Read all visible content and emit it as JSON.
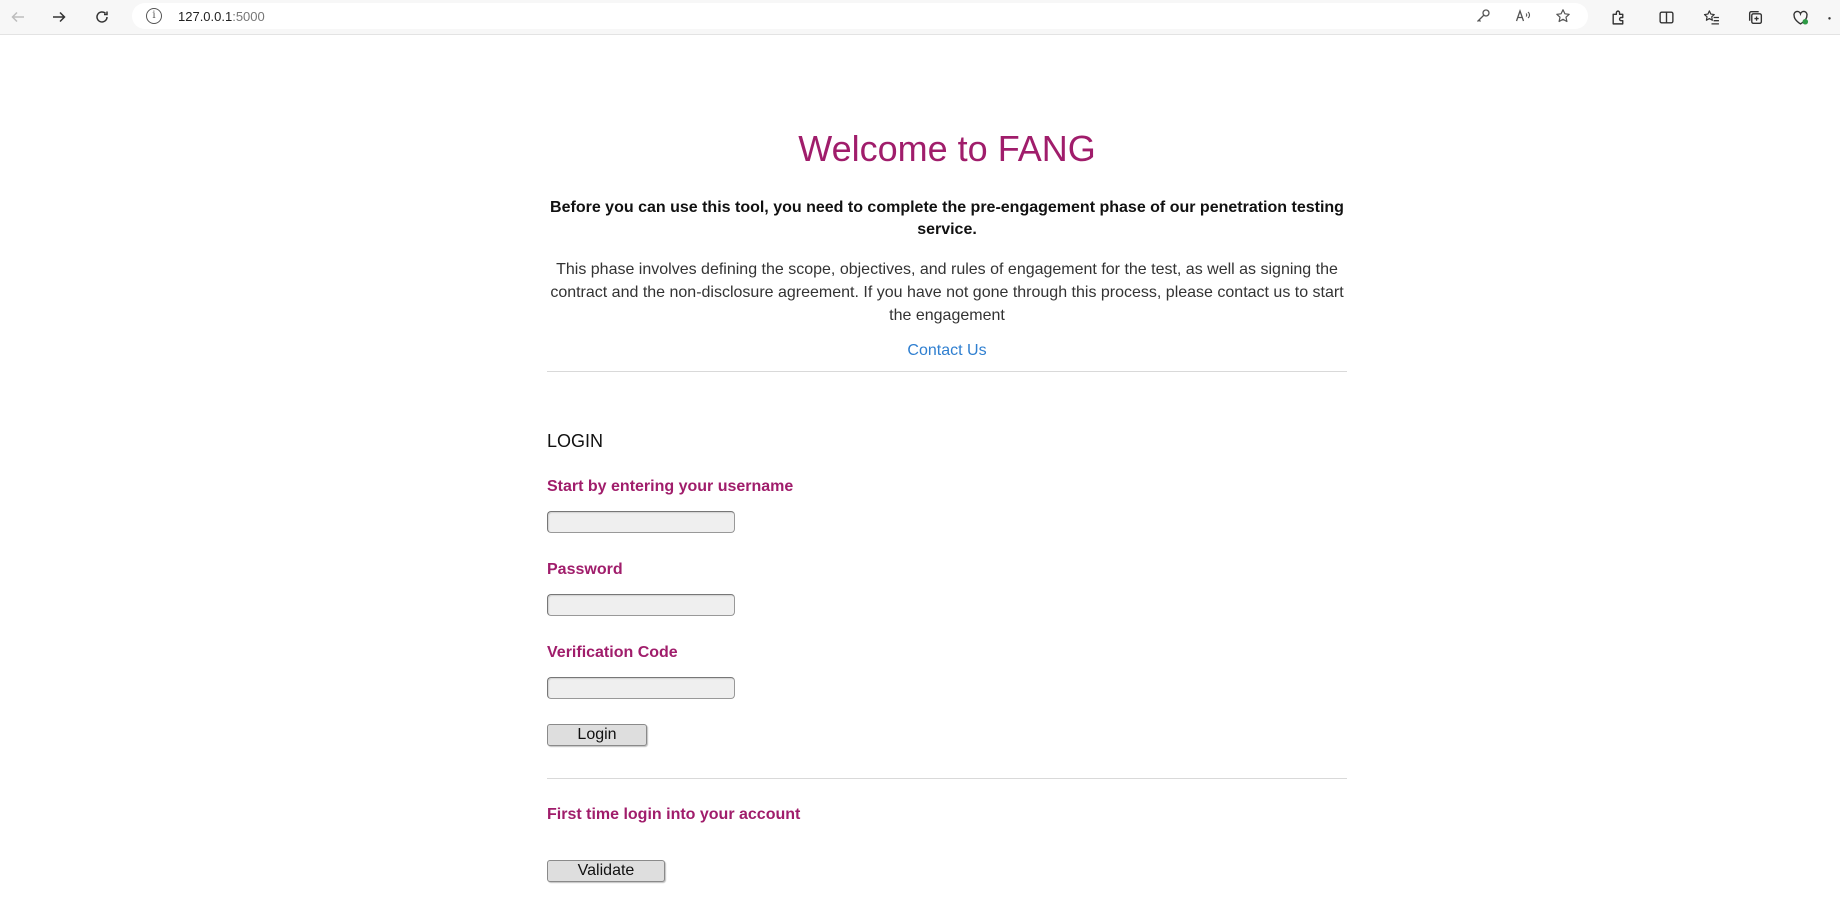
{
  "browser": {
    "url_host": "127.0.0.1",
    "url_port": ":5000",
    "icons": [
      "back-icon",
      "forward-icon",
      "refresh-icon",
      "info-icon",
      "key-icon",
      "read-aloud-icon",
      "favorite-star-icon",
      "extensions-icon",
      "split-screen-icon",
      "favorites-icon",
      "collections-icon",
      "browser-essentials-icon",
      "more-icon"
    ]
  },
  "page": {
    "title": "Welcome to FANG",
    "subtitle": "Before you can use this tool, you need to complete the pre-engagement phase of our penetration testing service.",
    "description": "This phase involves defining the scope, objectives, and rules of engagement for the test, as well as signing the contract and the non-disclosure agreement. If you have not gone through this process, please contact us to start the engagement",
    "contact_link": "Contact Us"
  },
  "login": {
    "heading": "LOGIN",
    "username_label": "Start by entering your username",
    "username_value": "",
    "password_label": "Password",
    "password_value": "",
    "verification_label": "Verification Code",
    "verification_value": "",
    "login_button": "Login"
  },
  "first_time": {
    "label": "First time login into your account",
    "validate_button": "Validate"
  },
  "colors": {
    "accent": "#a01d6b",
    "link": "#2f7fd0"
  }
}
